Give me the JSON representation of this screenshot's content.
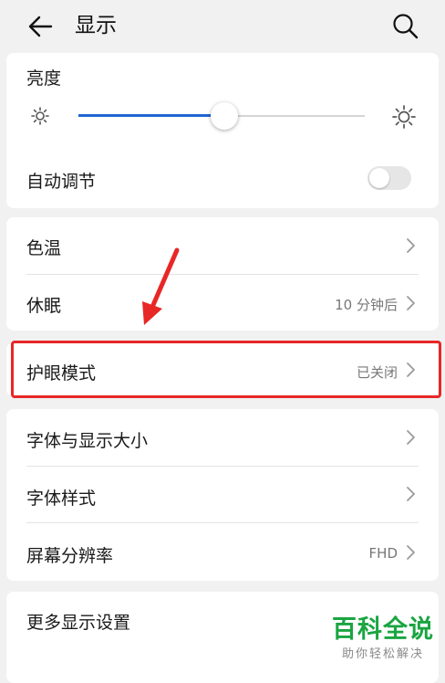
{
  "header": {
    "title": "显示",
    "back_icon": "arrow-left-icon",
    "search_icon": "search-icon"
  },
  "brightness": {
    "label": "亮度",
    "level": 0.5,
    "auto_adjust_label": "自动调节",
    "auto_adjust_on": false
  },
  "color_group": {
    "color_temp_label": "色温",
    "sleep_label": "休眠",
    "sleep_value": "10 分钟后"
  },
  "eye_comfort": {
    "label": "护眼模式",
    "value": "已关闭"
  },
  "font_group": {
    "font_display_size_label": "字体与显示大小",
    "font_style_label": "字体样式",
    "resolution_label": "屏幕分辨率",
    "resolution_value": "FHD"
  },
  "more": {
    "label": "更多显示设置"
  },
  "watermark": {
    "main": "百科全说",
    "sub": "助你轻松解决"
  },
  "colors": {
    "accent": "#1f66d1",
    "highlight": "#e82727",
    "watermark": "#1aa541"
  }
}
